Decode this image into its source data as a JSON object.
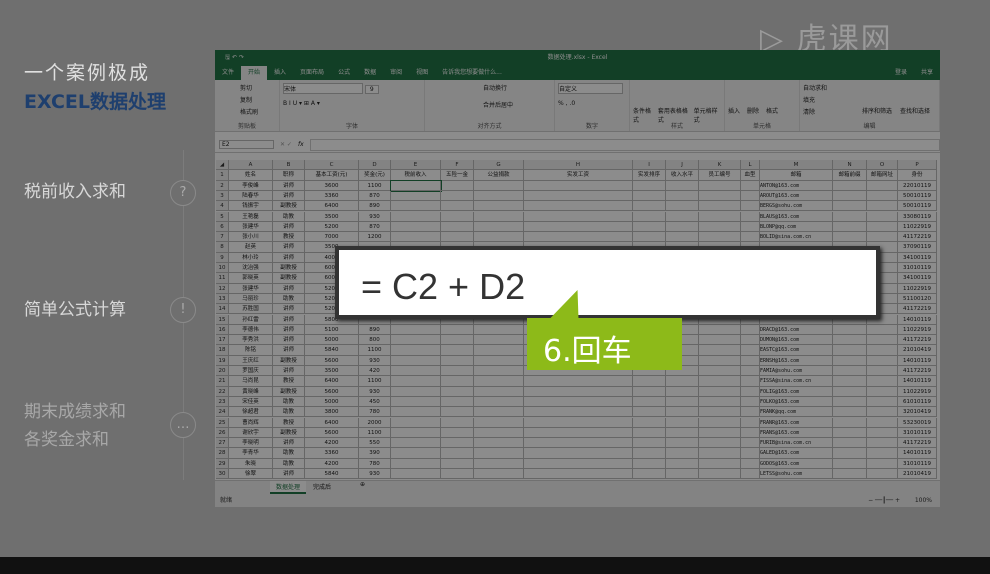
{
  "left": {
    "title1": "一个案例极成",
    "title2": "EXCEL数据处理",
    "items": [
      {
        "label": "税前收入求和",
        "icon": "question-icon",
        "glyph": "?"
      },
      {
        "label": "简单公式计算",
        "icon": "exclamation-icon",
        "glyph": "!"
      },
      {
        "label": "期末成绩求和",
        "label2": "各奖金求和",
        "icon": "more-icon",
        "glyph": "…"
      }
    ]
  },
  "logo": "虎课网",
  "excel": {
    "title": "数据处理.xlsx - Excel",
    "menu": [
      "文件",
      "开始",
      "插入",
      "页面布局",
      "公式",
      "数据",
      "审阅",
      "视图",
      "告诉我您想要做什么..."
    ],
    "login": "登录",
    "share": "共享",
    "ribbon": {
      "clipboard": [
        "粘贴",
        "剪切",
        "复制",
        "格式刷"
      ],
      "clipboard_label": "剪贴板",
      "font": "宋体",
      "font_size": "9",
      "font_label": "字体",
      "align": [
        "自动换行",
        "合并后居中"
      ],
      "align_label": "对齐方式",
      "number_format": "自定义",
      "number_label": "数字",
      "styles": [
        "条件格式",
        "套用表格格式",
        "单元格样式"
      ],
      "styles_label": "样式",
      "cells": [
        "插入",
        "删除",
        "格式"
      ],
      "cells_label": "单元格",
      "edit": [
        "自动求和",
        "填充",
        "清除",
        "排序和筛选",
        "查找和选择"
      ],
      "edit_label": "编辑"
    },
    "name_box": "E2",
    "fx": "fx",
    "columns": [
      "A",
      "B",
      "C",
      "D",
      "E",
      "F",
      "G",
      "H",
      "I",
      "J",
      "K",
      "L",
      "M",
      "N",
      "O",
      "P"
    ],
    "headers": [
      "姓名",
      "职称",
      "基本工资(元)",
      "奖金(元)",
      "税前收入",
      "五险一金",
      "公益捐款",
      "实发工资",
      "实发排序",
      "收入水平",
      "员工编号",
      "血型",
      "邮箱",
      "邮箱前缀",
      "邮箱网址",
      "身份"
    ],
    "rows": [
      [
        "李俊峰",
        "讲师",
        "3600",
        "1100",
        "ANTON@163.com",
        "22010119"
      ],
      [
        "陆春华",
        "讲师",
        "3360",
        "870",
        "AROUT@163.com",
        "50010119"
      ],
      [
        "钱振宇",
        "副教授",
        "6400",
        "890",
        "BERGS@sohu.com",
        "50010119"
      ],
      [
        "王艳磊",
        "助教",
        "3500",
        "930",
        "BLAUS@163.com",
        "33080119"
      ],
      [
        "张建华",
        "讲师",
        "5200",
        "870",
        "BLONP@qq.com",
        "11022919"
      ],
      [
        "张小川",
        "教授",
        "7000",
        "1200",
        "BOLID@sina.com.cn",
        "41172219"
      ],
      [
        "赵英",
        "讲师",
        "3500",
        "",
        "",
        "37090119"
      ],
      [
        "林小玲",
        "讲师",
        "4000",
        "",
        "",
        "34100119"
      ],
      [
        "沈冶强",
        "副教授",
        "6000",
        "",
        "",
        "31010119"
      ],
      [
        "郭晓英",
        "副教授",
        "6000",
        "",
        "",
        "34100119"
      ],
      [
        "张建华",
        "讲师",
        "5200",
        "",
        "",
        "11022919"
      ],
      [
        "马丽珍",
        "助教",
        "5200",
        "",
        "",
        "51100120"
      ],
      [
        "苏胜国",
        "讲师",
        "5200",
        "",
        "",
        "41172219"
      ],
      [
        "孙红雷",
        "讲师",
        "5800",
        "",
        "",
        "14010119"
      ],
      [
        "李德伟",
        "讲师",
        "5100",
        "890",
        "DRACD@163.com",
        "11022919"
      ],
      [
        "李秀洪",
        "讲师",
        "5000",
        "800",
        "DUMON@163.com",
        "41172219"
      ],
      [
        "陈铭",
        "讲师",
        "5840",
        "1100",
        "EASTC@163.com",
        "21010419"
      ],
      [
        "王庆红",
        "副教授",
        "5600",
        "930",
        "ERNSH@163.com",
        "14010119"
      ],
      [
        "罗国庆",
        "讲师",
        "3500",
        "420",
        "FAMIA@sohu.com",
        "41172219"
      ],
      [
        "马尚昆",
        "教授",
        "6400",
        "1100",
        "FISSA@sina.com.cn",
        "14010119"
      ],
      [
        "黄晓峰",
        "副教授",
        "5600",
        "930",
        "FOLIG@163.com",
        "11022919"
      ],
      [
        "宋佳英",
        "助教",
        "5000",
        "450",
        "FOLKO@163.com",
        "61010119"
      ],
      [
        "徐超君",
        "助教",
        "3800",
        "780",
        "FRANK@qq.com",
        "32010419"
      ],
      [
        "曹尚辉",
        "教授",
        "6400",
        "2000",
        "FRANR@163.com",
        "53230019"
      ],
      [
        "谢欣宇",
        "副教授",
        "5600",
        "1100",
        "FRANS@163.com",
        "31010119"
      ],
      [
        "李晓明",
        "讲师",
        "4200",
        "550",
        "FURIB@sina.com.cn",
        "41172219"
      ],
      [
        "李青华",
        "助教",
        "3360",
        "390",
        "GALED@163.com",
        "14010119"
      ],
      [
        "朱晓",
        "助教",
        "4200",
        "780",
        "GODOS@163.com",
        "31010119"
      ],
      [
        "徐翠",
        "讲师",
        "5840",
        "930",
        "LETSS@sohu.com",
        "21010419"
      ]
    ],
    "sheets": [
      "数据处理",
      "完成后"
    ],
    "status": "就绪",
    "zoom": "100%"
  },
  "callout": "= C2 + D2",
  "tag": "6.回车",
  "colors": {
    "excel_green": "#217346",
    "tag_green": "#8dba19"
  }
}
